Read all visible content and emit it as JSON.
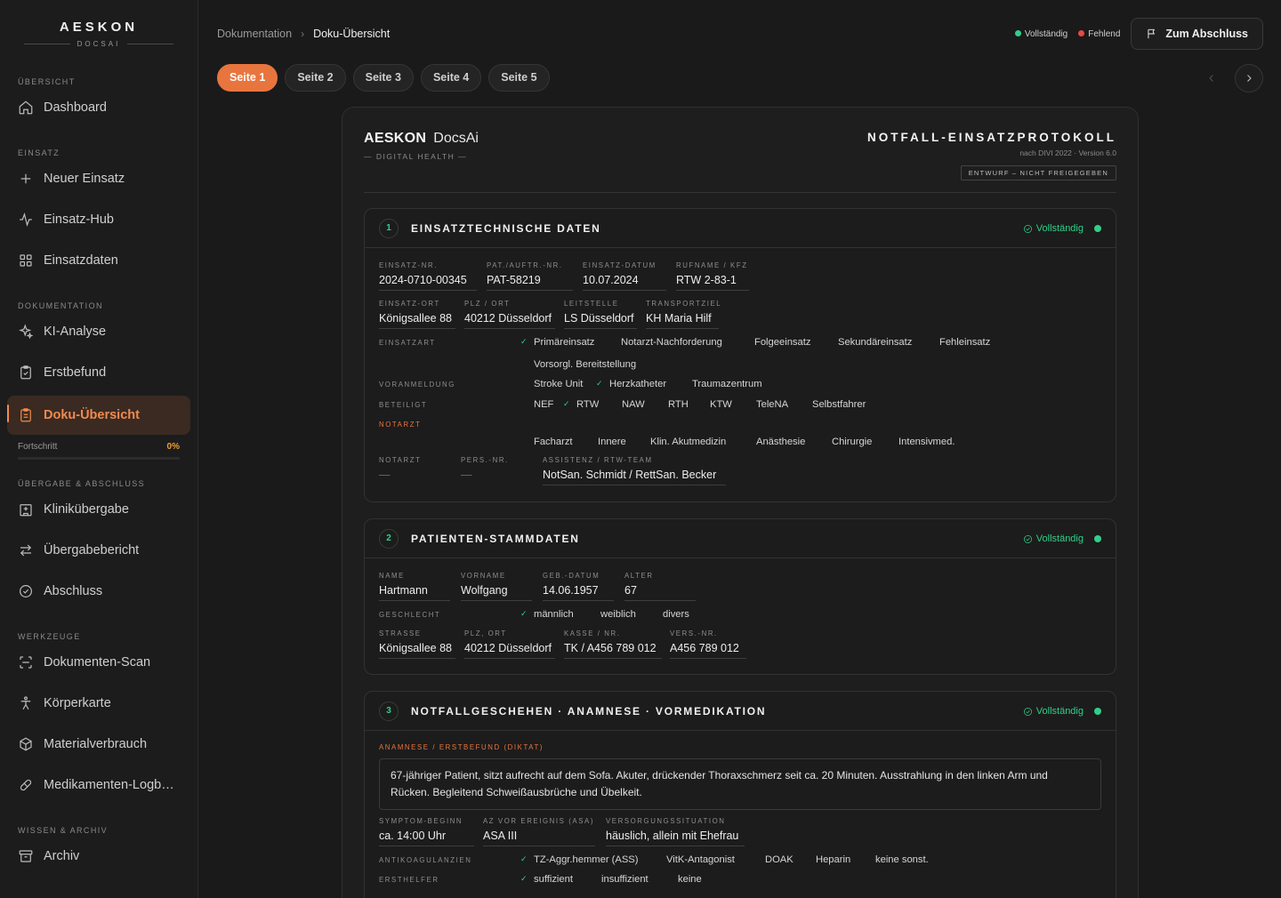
{
  "logo": {
    "main": "AESKON",
    "sub": "DOCSAI"
  },
  "sidebar": {
    "sections": {
      "overview": "ÜBERSICHT",
      "einsatz": "EINSATZ",
      "doku": "DOKUMENTATION",
      "uebergabe": "ÜBERGABE & ABSCHLUSS",
      "tools": "WERKZEUGE",
      "wissen": "WISSEN & ARCHIV"
    },
    "items": {
      "dashboard": "Dashboard",
      "neuer_einsatz": "Neuer Einsatz",
      "einsatz_hub": "Einsatz-Hub",
      "einsatzdaten": "Einsatzdaten",
      "ki_analyse": "KI-Analyse",
      "erstbefund": "Erstbefund",
      "doku_uebersicht": "Doku-Übersicht",
      "klinik": "Klinikübergabe",
      "uebergabebericht": "Übergabebericht",
      "abschluss": "Abschluss",
      "scan": "Dokumenten-Scan",
      "koerperkarte": "Körperkarte",
      "material": "Materialverbrauch",
      "medikamente": "Medikamenten-Logb…",
      "archiv": "Archiv"
    },
    "progress": {
      "label": "Fortschritt",
      "value": "0%",
      "fraction": 0
    }
  },
  "header": {
    "breadcrumb": [
      "Dokumentation",
      "Doku-Übersicht"
    ],
    "legend": {
      "complete": "Vollständig",
      "missing": "Fehlend"
    },
    "close_button": "Zum Abschluss",
    "colors": {
      "complete": "#2fd08a",
      "missing": "#e84848",
      "accent": "#e8753e"
    }
  },
  "tabs": [
    "Seite 1",
    "Seite 2",
    "Seite 3",
    "Seite 4",
    "Seite 5"
  ],
  "document": {
    "brand_bold": "AESKON",
    "brand_light": "DocsAi",
    "brand_sub": "— DIGITAL HEALTH —",
    "title": "NOTFALL-EINSATZPROTOKOLL",
    "version": "nach DIVI 2022 · Version 6.0",
    "badge": "ENTWURF – NICHT FREIGEGEBEN"
  },
  "section1": {
    "num": "1",
    "title": "EINSATZTECHNISCHE DATEN",
    "status": "Vollständig",
    "fields": {
      "einsatz_nr": {
        "label": "EINSATZ-NR.",
        "value": "2024-0710-00345"
      },
      "pat_nr": {
        "label": "PAT./AUFTR.-NR.",
        "value": "PAT-58219"
      },
      "datum": {
        "label": "EINSATZ-DATUM",
        "value": "10.07.2024"
      },
      "rufname": {
        "label": "RUFNAME / KFZ",
        "value": "RTW 2-83-1"
      },
      "ort": {
        "label": "EINSATZ-ORT",
        "value": "Königsallee 88"
      },
      "plz": {
        "label": "PLZ / ORT",
        "value": "40212 Düsseldorf"
      },
      "leitstelle": {
        "label": "LEITSTELLE",
        "value": "LS Düsseldorf"
      },
      "transportziel": {
        "label": "TRANSPORTZIEL",
        "value": "KH Maria Hilf"
      },
      "notarzt": {
        "label": "NOTARZT",
        "value": "—"
      },
      "pers_nr": {
        "label": "PERS.-NR.",
        "value": "—"
      },
      "assistenz": {
        "label": "ASSISTENZ / RTW-TEAM",
        "value": "NotSan. Schmidt / RettSan. Becker"
      }
    },
    "einsatzart": {
      "label": "EINSATZART",
      "options": [
        "Primäreinsatz",
        "Notarzt-Nachforderung",
        "Folgeeinsatz",
        "Sekundäreinsatz",
        "Fehleinsatz",
        "Vorsorgl. Bereitstellung"
      ]
    },
    "voranmeldung": {
      "label": "VORANMELDUNG",
      "options": [
        "Stroke Unit",
        "Herzkatheter",
        "Traumazentrum"
      ]
    },
    "beteiligt": {
      "label": "BETEILIGT",
      "options": [
        "NEF",
        "RTW",
        "NAW",
        "RTH",
        "KTW",
        "TeleNA",
        "Selbstfahrer"
      ]
    },
    "notarzt_group": {
      "label": "NOTARZT",
      "options": [
        "Facharzt",
        "Innere",
        "Klin. Akutmedizin",
        "Anästhesie",
        "Chirurgie",
        "Intensivmed."
      ]
    }
  },
  "section2": {
    "num": "2",
    "title": "PATIENTEN-STAMMDATEN",
    "status": "Vollständig",
    "fields": {
      "name": {
        "label": "NAME",
        "value": "Hartmann"
      },
      "vorname": {
        "label": "VORNAME",
        "value": "Wolfgang"
      },
      "geb": {
        "label": "GEB.-DATUM",
        "value": "14.06.1957"
      },
      "alter": {
        "label": "ALTER",
        "value": "67"
      },
      "strasse": {
        "label": "STRASSE",
        "value": "Königsallee 88"
      },
      "plz": {
        "label": "PLZ, ORT",
        "value": "40212 Düsseldorf"
      },
      "kasse": {
        "label": "KASSE / NR.",
        "value": "TK / A456 789 012"
      },
      "vers": {
        "label": "VERS.-NR.",
        "value": "A456 789 012"
      }
    },
    "geschlecht": {
      "label": "GESCHLECHT",
      "options": [
        "männlich",
        "weiblich",
        "divers"
      ]
    }
  },
  "section3": {
    "num": "3",
    "title": "NOTFALLGESCHEHEN · ANAMNESE · VORMEDIKATION",
    "status": "Vollständig",
    "anamnese_label": "ANAMNESE / ERSTBEFUND (DIKTAT)",
    "anamnese_text": "67-jähriger Patient, sitzt aufrecht auf dem Sofa. Akuter, drückender Thoraxschmerz seit ca. 20 Minuten. Ausstrahlung in den linken Arm und Rücken. Begleitend Schweißausbrüche und Übelkeit.",
    "fields": {
      "symptom": {
        "label": "SYMPTOM-BEGINN",
        "value": "ca. 14:00 Uhr"
      },
      "az": {
        "label": "AZ VOR EREIGNIS (ASA)",
        "value": "ASA III"
      },
      "versorgung": {
        "label": "VERSORGUNGSSITUATION",
        "value": "häuslich, allein mit Ehefrau"
      }
    },
    "antikoag": {
      "label": "ANTIKOAGULANZIEN",
      "options": [
        "TZ-Aggr.hemmer (ASS)",
        "VitK-Antagonist",
        "DOAK",
        "Heparin",
        "keine sonst."
      ]
    },
    "ersthelfer": {
      "label": "ERSTHELFER",
      "options": [
        "suffizient",
        "insuffizient",
        "keine"
      ]
    }
  }
}
